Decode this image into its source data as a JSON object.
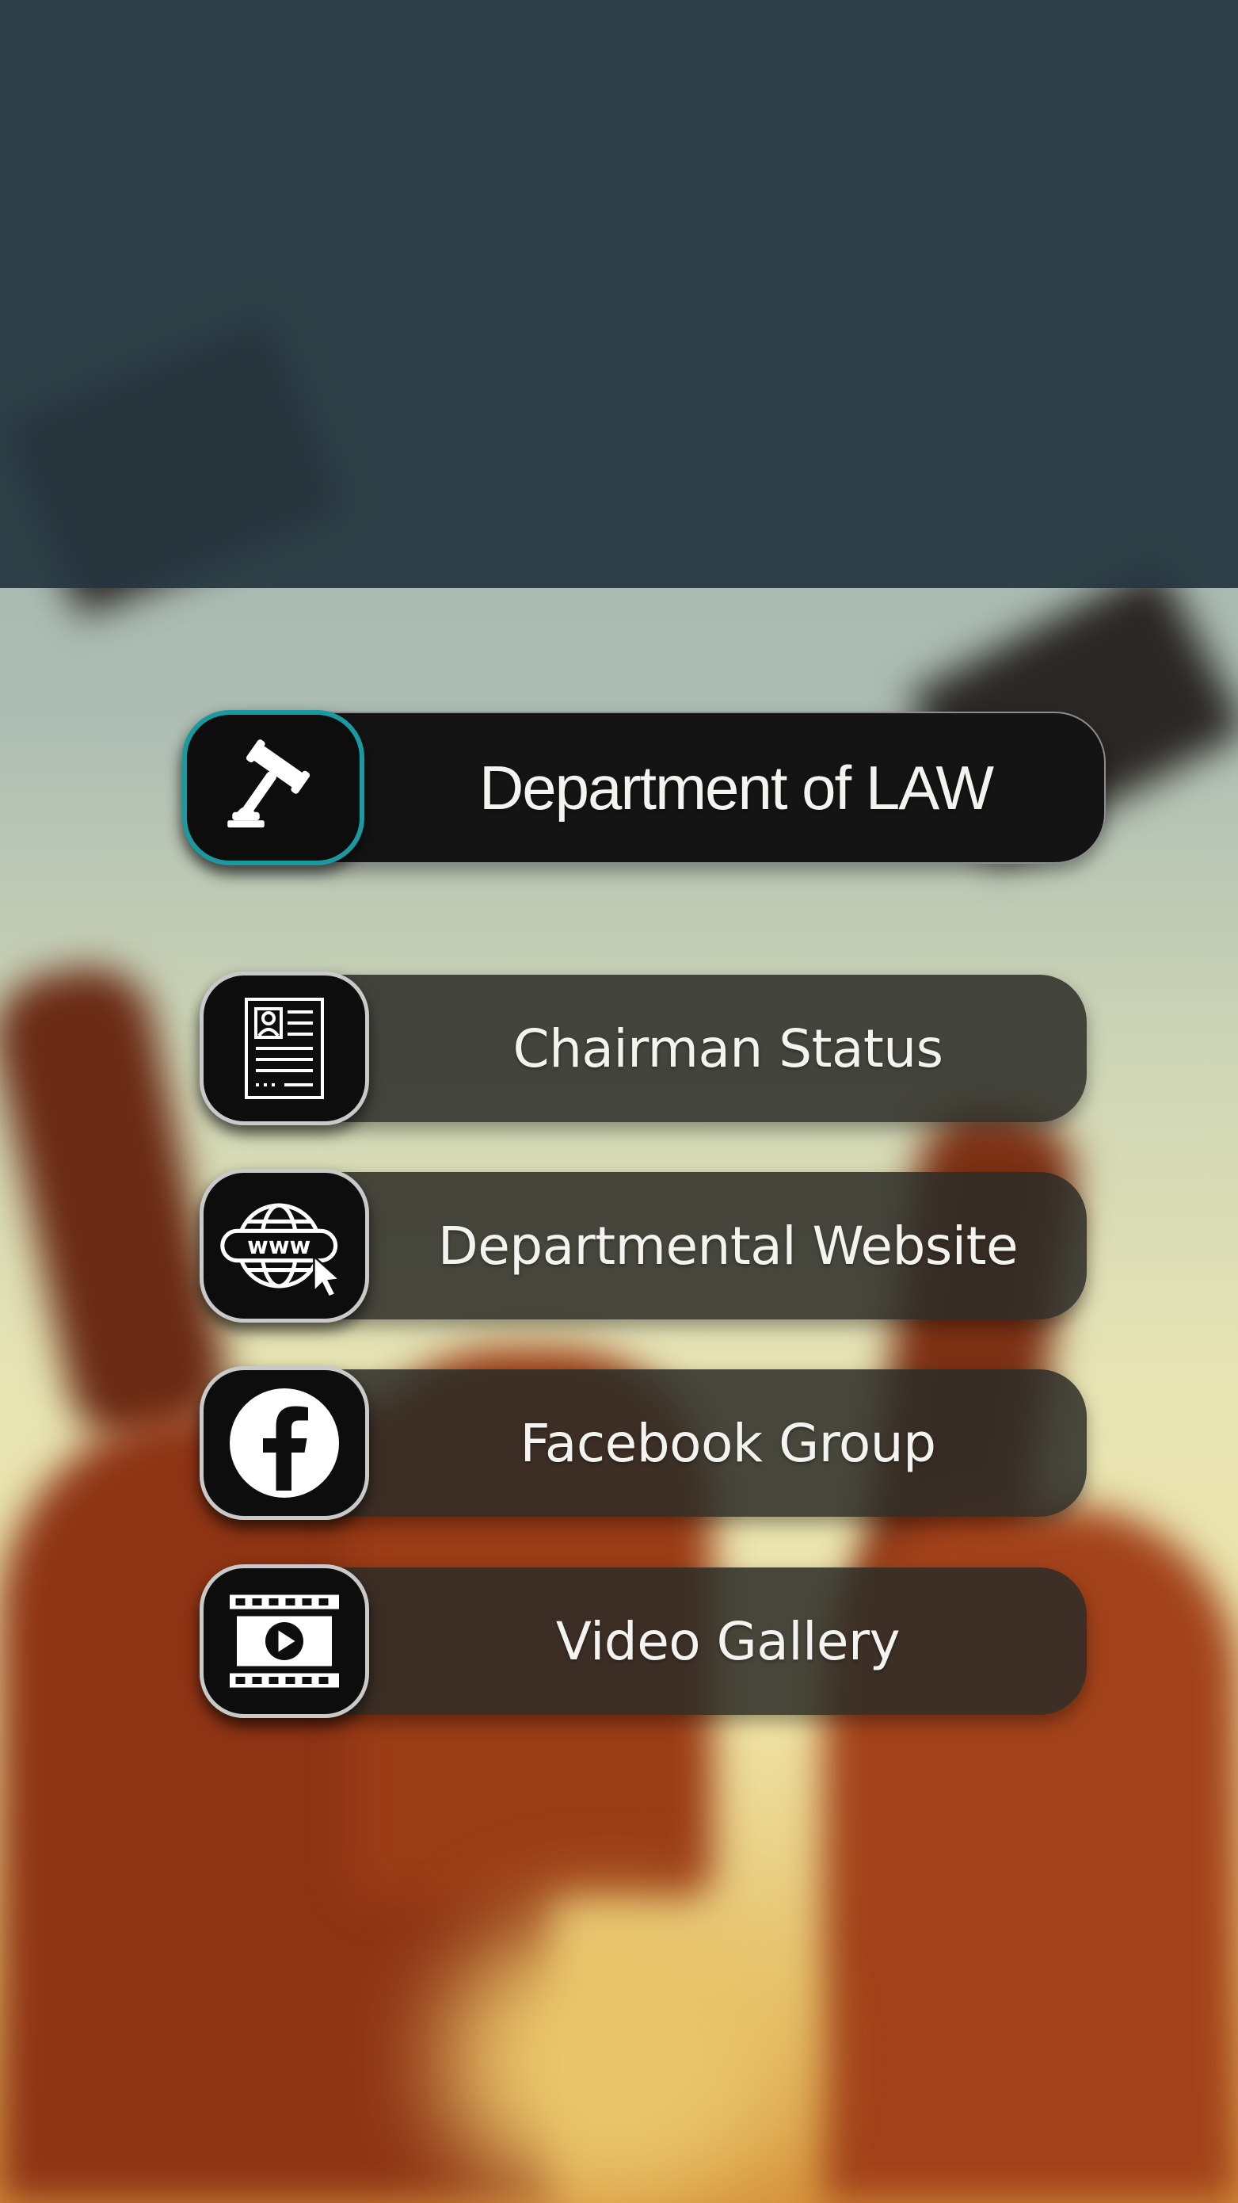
{
  "page": {
    "title": "Department of  LAW"
  },
  "menu": {
    "items": [
      {
        "label": "Chairman Status",
        "icon": "profile-document-icon"
      },
      {
        "label": "Departmental Website",
        "icon": "www-globe-icon"
      },
      {
        "label": "Facebook Group",
        "icon": "facebook-icon"
      },
      {
        "label": "Video Gallery",
        "icon": "video-play-icon"
      }
    ]
  },
  "title_icon": "gavel-icon",
  "colors": {
    "header_overlay": "#26363e",
    "button_bg": "#2c2c28",
    "featured_bg": "#141414",
    "icon_border": "#c9c9c9",
    "featured_icon_border": "#1a9aa0",
    "text": "#f3f3ef"
  }
}
